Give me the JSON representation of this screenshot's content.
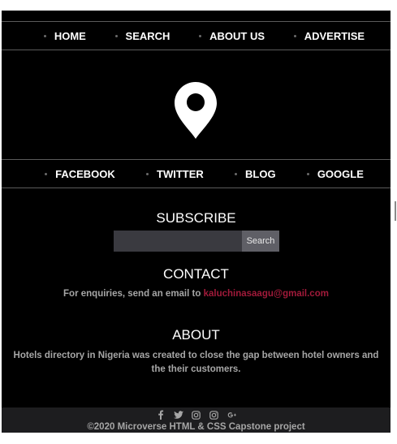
{
  "top_nav": {
    "items": [
      {
        "label": "HOME"
      },
      {
        "label": "SEARCH"
      },
      {
        "label": "ABOUT US"
      },
      {
        "label": "ADVERTISE"
      }
    ]
  },
  "logo": {
    "icon": "map-pin-icon"
  },
  "social_nav": {
    "items": [
      {
        "label": "FACEBOOK"
      },
      {
        "label": "TWITTER"
      },
      {
        "label": "BLOG"
      },
      {
        "label": "GOOGLE"
      }
    ]
  },
  "subscribe": {
    "title": "SUBSCRIBE",
    "input_value": "",
    "button_label": "Search"
  },
  "contact": {
    "title": "CONTACT",
    "text": "For enquiries, send an email to ",
    "email": "kaluchinasaagu@gmail.com"
  },
  "about": {
    "title": "ABOUT",
    "text": "Hotels directory in Nigeria was created to close the gap between hotel owners and the their customers."
  },
  "footer": {
    "icons": [
      "facebook-icon",
      "twitter-icon",
      "instagram-icon",
      "instagram-icon",
      "google-plus-icon"
    ],
    "copyright": "©2020 Microverse HTML & CSS Capstone project"
  },
  "colors": {
    "background": "#000000",
    "text": "#ffffff",
    "muted": "#a6a6a6",
    "link": "#a11a3a",
    "bottom_bar": "#1d1d1f"
  }
}
